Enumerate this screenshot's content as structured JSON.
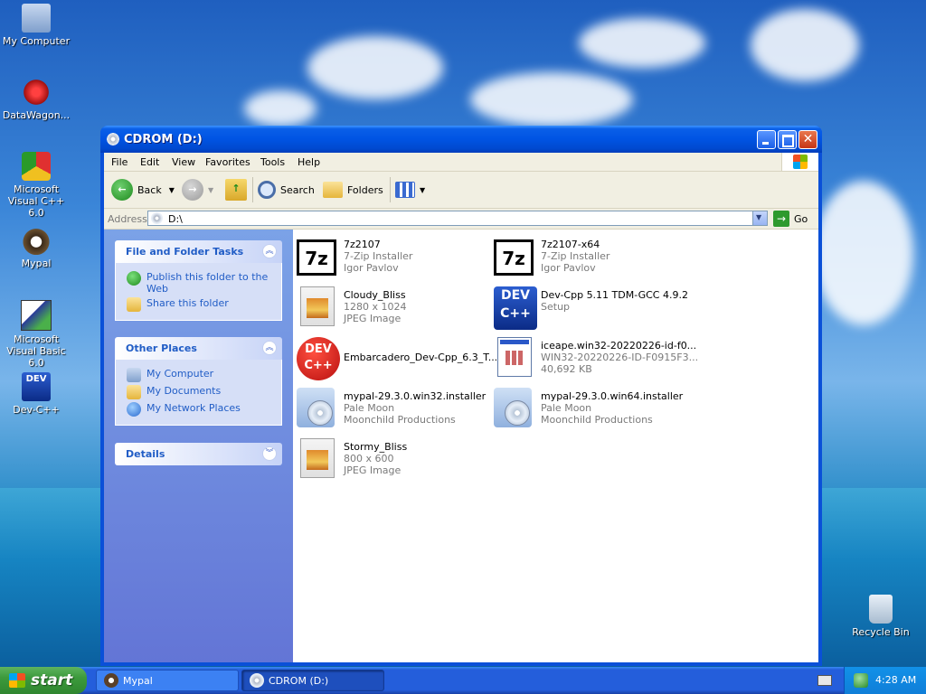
{
  "desktop": {
    "icons": [
      {
        "label": "My Computer",
        "icon": "my-computer-icon"
      },
      {
        "label": "DataWagon...",
        "icon": "datawagon-icon"
      },
      {
        "label": "Microsoft Visual C++ 6.0",
        "icon": "visual-cpp-icon"
      },
      {
        "label": "Mypal",
        "icon": "mypal-icon"
      },
      {
        "label": "Microsoft Visual Basic 6.0",
        "icon": "visual-basic-icon"
      },
      {
        "label": "Dev-C++",
        "icon": "devcpp-icon"
      }
    ],
    "recycle_bin": "Recycle Bin"
  },
  "window": {
    "title": "CDROM (D:)",
    "menu": [
      "File",
      "Edit",
      "View",
      "Favorites",
      "Tools",
      "Help"
    ],
    "toolbar": {
      "back": "Back",
      "search": "Search",
      "folders": "Folders"
    },
    "address": {
      "label": "Address",
      "value": "D:\\",
      "go": "Go"
    }
  },
  "sidebar": {
    "file_tasks": {
      "title": "File and Folder Tasks",
      "items": [
        "Publish this folder to the Web",
        "Share this folder"
      ]
    },
    "other_places": {
      "title": "Other Places",
      "items": [
        "My Computer",
        "My Documents",
        "My Network Places"
      ]
    },
    "details": {
      "title": "Details"
    }
  },
  "files": [
    {
      "name": "7z2107",
      "line2": "7-Zip Installer",
      "line3": "Igor Pavlov",
      "icon": "7zip-icon"
    },
    {
      "name": "7z2107-x64",
      "line2": "7-Zip Installer",
      "line3": "Igor Pavlov",
      "icon": "7zip-icon"
    },
    {
      "name": "Cloudy_Bliss",
      "line2": "1280 x 1024",
      "line3": "JPEG Image",
      "icon": "jpeg-icon"
    },
    {
      "name": "Dev-Cpp 5.11 TDM-GCC 4.9.2",
      "line2": "Setup",
      "line3": "",
      "icon": "devcpp-setup-icon"
    },
    {
      "name": "Embarcadero_Dev-Cpp_6.3_T...",
      "line2": "",
      "line3": "",
      "icon": "embarcadero-devcpp-icon"
    },
    {
      "name": "iceape.win32-20220226-id-f0...",
      "line2": "WIN32-20220226-ID-F0915F3...",
      "line3": "40,692 KB",
      "icon": "executable-icon"
    },
    {
      "name": "mypal-29.3.0.win32.installer",
      "line2": "Pale Moon",
      "line3": "Moonchild Productions",
      "icon": "installer-icon"
    },
    {
      "name": "mypal-29.3.0.win64.installer",
      "line2": "Pale Moon",
      "line3": "Moonchild Productions",
      "icon": "installer-icon"
    },
    {
      "name": "Stormy_Bliss",
      "line2": "800 x 600",
      "line3": "JPEG Image",
      "icon": "jpeg-icon"
    }
  ],
  "taskbar": {
    "start": "start",
    "tasks": [
      "Mypal",
      "CDROM (D:)"
    ],
    "clock": "4:28 AM"
  }
}
